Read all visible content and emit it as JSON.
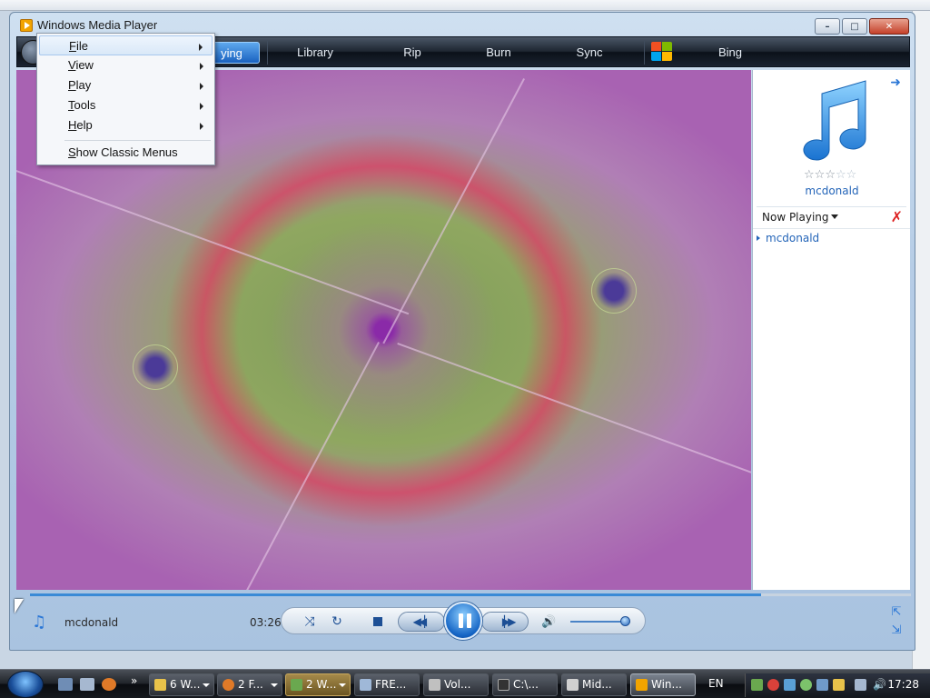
{
  "window": {
    "title": "Windows Media Player",
    "minimize": "–",
    "maximize": "□",
    "close": "✕"
  },
  "nav": {
    "tabs": [
      {
        "label": "ying",
        "active": true
      },
      {
        "label": "Library",
        "active": false
      },
      {
        "label": "Rip",
        "active": false
      },
      {
        "label": "Burn",
        "active": false
      },
      {
        "label": "Sync",
        "active": false
      },
      {
        "label": "Bing",
        "active": false
      }
    ]
  },
  "menu": {
    "items": [
      {
        "label": "File",
        "submenu": true
      },
      {
        "label": "View",
        "submenu": true
      },
      {
        "label": "Play",
        "submenu": true
      },
      {
        "label": "Tools",
        "submenu": true
      },
      {
        "label": "Help",
        "submenu": true
      }
    ],
    "classic": "Show Classic Menus"
  },
  "panel": {
    "album_name": "mcdonald",
    "rating_stars": 3,
    "rating_max": 5,
    "now_playing_label": "Now Playing",
    "playlist": [
      "mcdonald"
    ]
  },
  "player": {
    "track_name": "mcdonald",
    "elapsed": "03:26",
    "seek_fraction": 0.83,
    "volume_fraction": 0.85
  },
  "taskbar": {
    "tasks": [
      {
        "label": "6 W...",
        "icon_color": "#e8c24a",
        "dropdown": true
      },
      {
        "label": "2 F...",
        "icon_color": "#e07a28",
        "dropdown": true
      },
      {
        "label": "2 W...",
        "icon_color": "#6aa84f",
        "dropdown": true
      },
      {
        "label": "FRE...",
        "icon_color": "#9fb8d8",
        "dropdown": false
      },
      {
        "label": "Vol...",
        "icon_color": "#c0c0c0",
        "dropdown": false
      },
      {
        "label": "C:\\...",
        "icon_color": "#333333",
        "dropdown": false
      },
      {
        "label": "Mid...",
        "icon_color": "#d0d0d0",
        "dropdown": false
      },
      {
        "label": "Win...",
        "icon_color": "#f2a400",
        "dropdown": false
      }
    ],
    "language": "EN",
    "clock": "17:28",
    "show_more": "»"
  },
  "colors": {
    "accent": "#2b77d6",
    "nav_bg": "#1e2631",
    "link": "#2364b8"
  }
}
